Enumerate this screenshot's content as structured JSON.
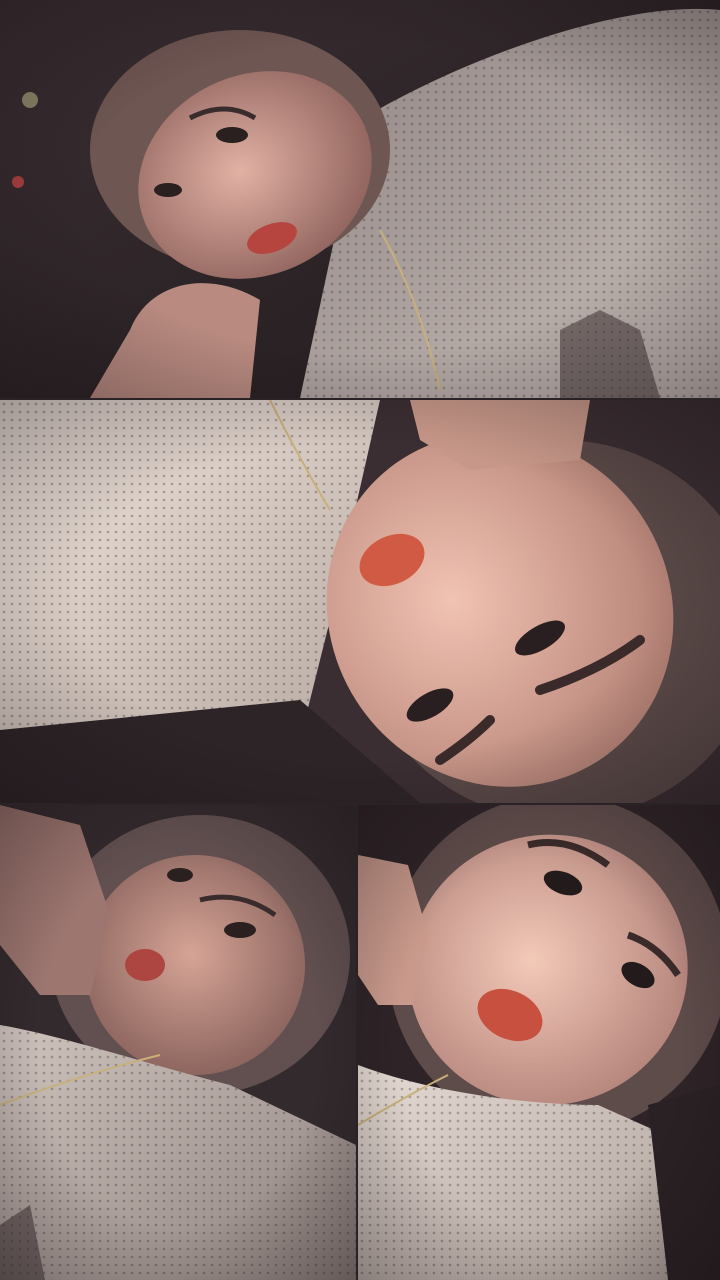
{
  "collage": {
    "panels": [
      {
        "id": "top",
        "subject": "selfie-reclining-mesh-jersey"
      },
      {
        "id": "middle",
        "subject": "selfie-rotated-close-up"
      },
      {
        "id": "bottom-left",
        "subject": "selfie-tilted-hand-on-face"
      },
      {
        "id": "bottom-right",
        "subject": "selfie-hand-by-ear"
      }
    ]
  },
  "colors": {
    "background": "#2a2326",
    "skin": "#d8a89a",
    "skin_shadow": "#9c6e68",
    "lips": "#c0504a",
    "jersey": "#e6ddd7",
    "jersey_shadow": "#a89c97",
    "hair": "#6a5450",
    "dark": "#2b2226"
  }
}
